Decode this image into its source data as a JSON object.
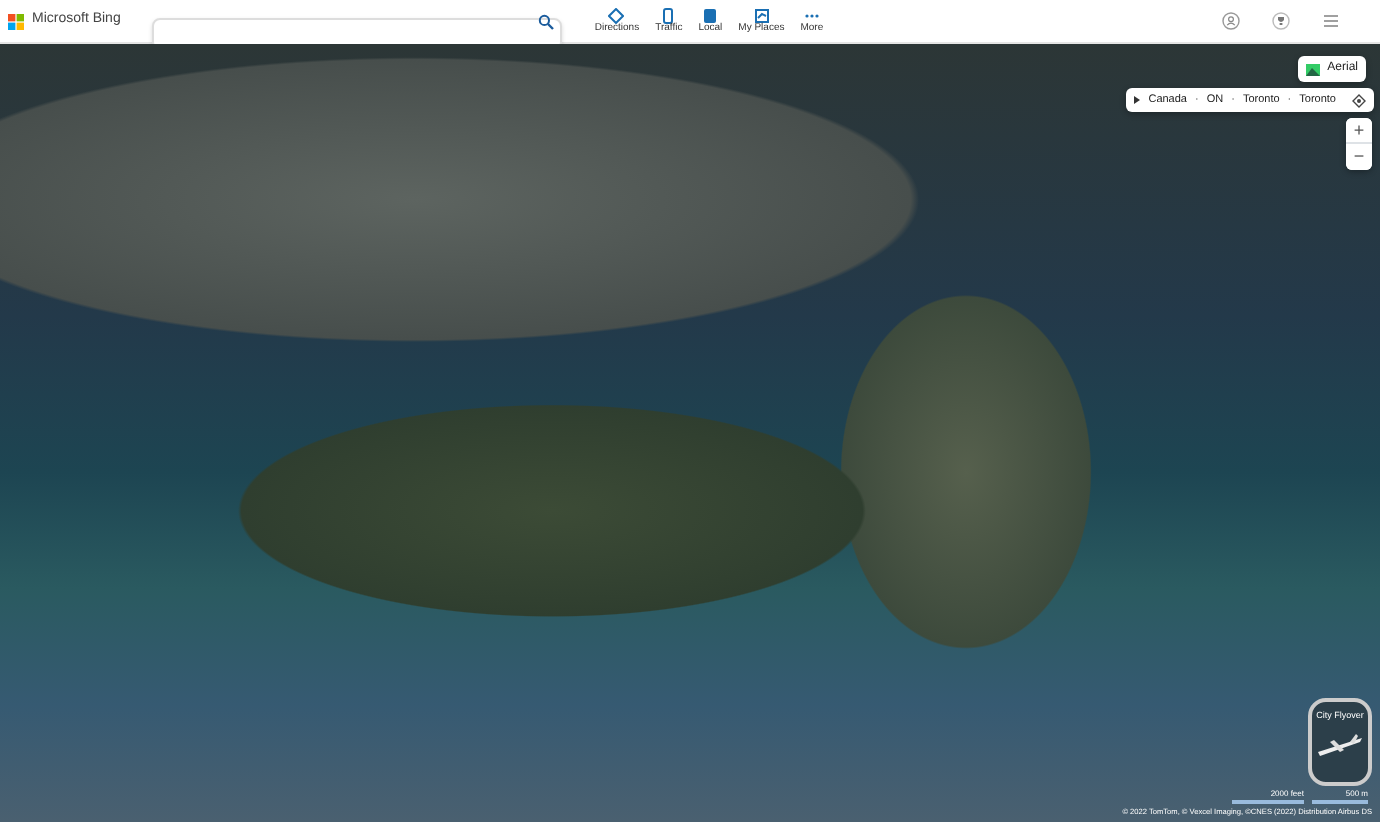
{
  "header": {
    "logo": "Microsoft Bing",
    "nav": [
      {
        "label": "Directions",
        "selected": false
      },
      {
        "label": "Traffic",
        "selected": false
      },
      {
        "label": "Local",
        "selected": false
      },
      {
        "label": "My Places",
        "selected": false
      },
      {
        "label": "More",
        "selected": false
      }
    ]
  },
  "map": {
    "view_button": "Aerial",
    "breadcrumb": {
      "items": [
        "Canada",
        "ON",
        "Toronto",
        "Toronto"
      ],
      "separator": "·"
    },
    "zoom_in": "+",
    "zoom_out": "−",
    "flyover": "City Flyover",
    "scale": {
      "imperial": "2000 feet",
      "metric": "500 m"
    },
    "copyright": "© 2022 TomTom, © Vexcel Imaging, ©CNES (2022) Distribution Airbus DS"
  }
}
